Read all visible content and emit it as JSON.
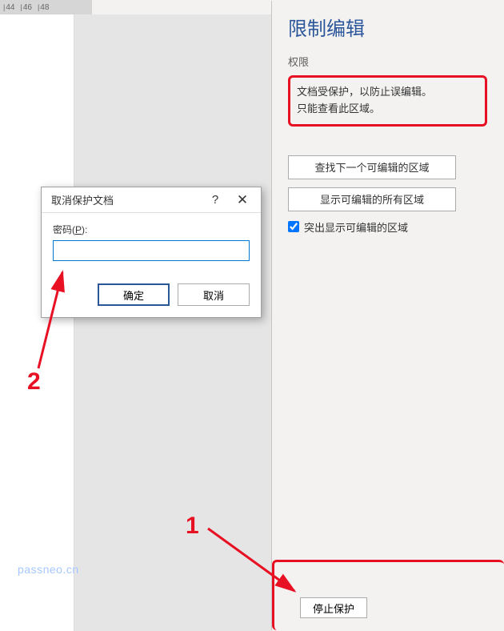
{
  "ruler": {
    "marks": [
      "44",
      "46",
      "48"
    ]
  },
  "panel": {
    "title": "限制编辑",
    "subtitle": "权限",
    "protected_line1": "文档受保护，以防止误编辑。",
    "protected_line2": "只能查看此区域。",
    "btn_find_next": "查找下一个可编辑的区域",
    "btn_show_all": "显示可编辑的所有区域",
    "checkbox_label": "突出显示可编辑的区域",
    "checkbox_checked": true,
    "btn_stop": "停止保护"
  },
  "dialog": {
    "title": "取消保护文档",
    "help": "?",
    "close": "✕",
    "password_label_prefix": "密码(",
    "password_label_key": "P",
    "password_label_suffix": "):",
    "ok": "确定",
    "cancel": "取消"
  },
  "annotations": {
    "label1": "1",
    "label2": "2"
  },
  "watermark": "passneo.cn"
}
